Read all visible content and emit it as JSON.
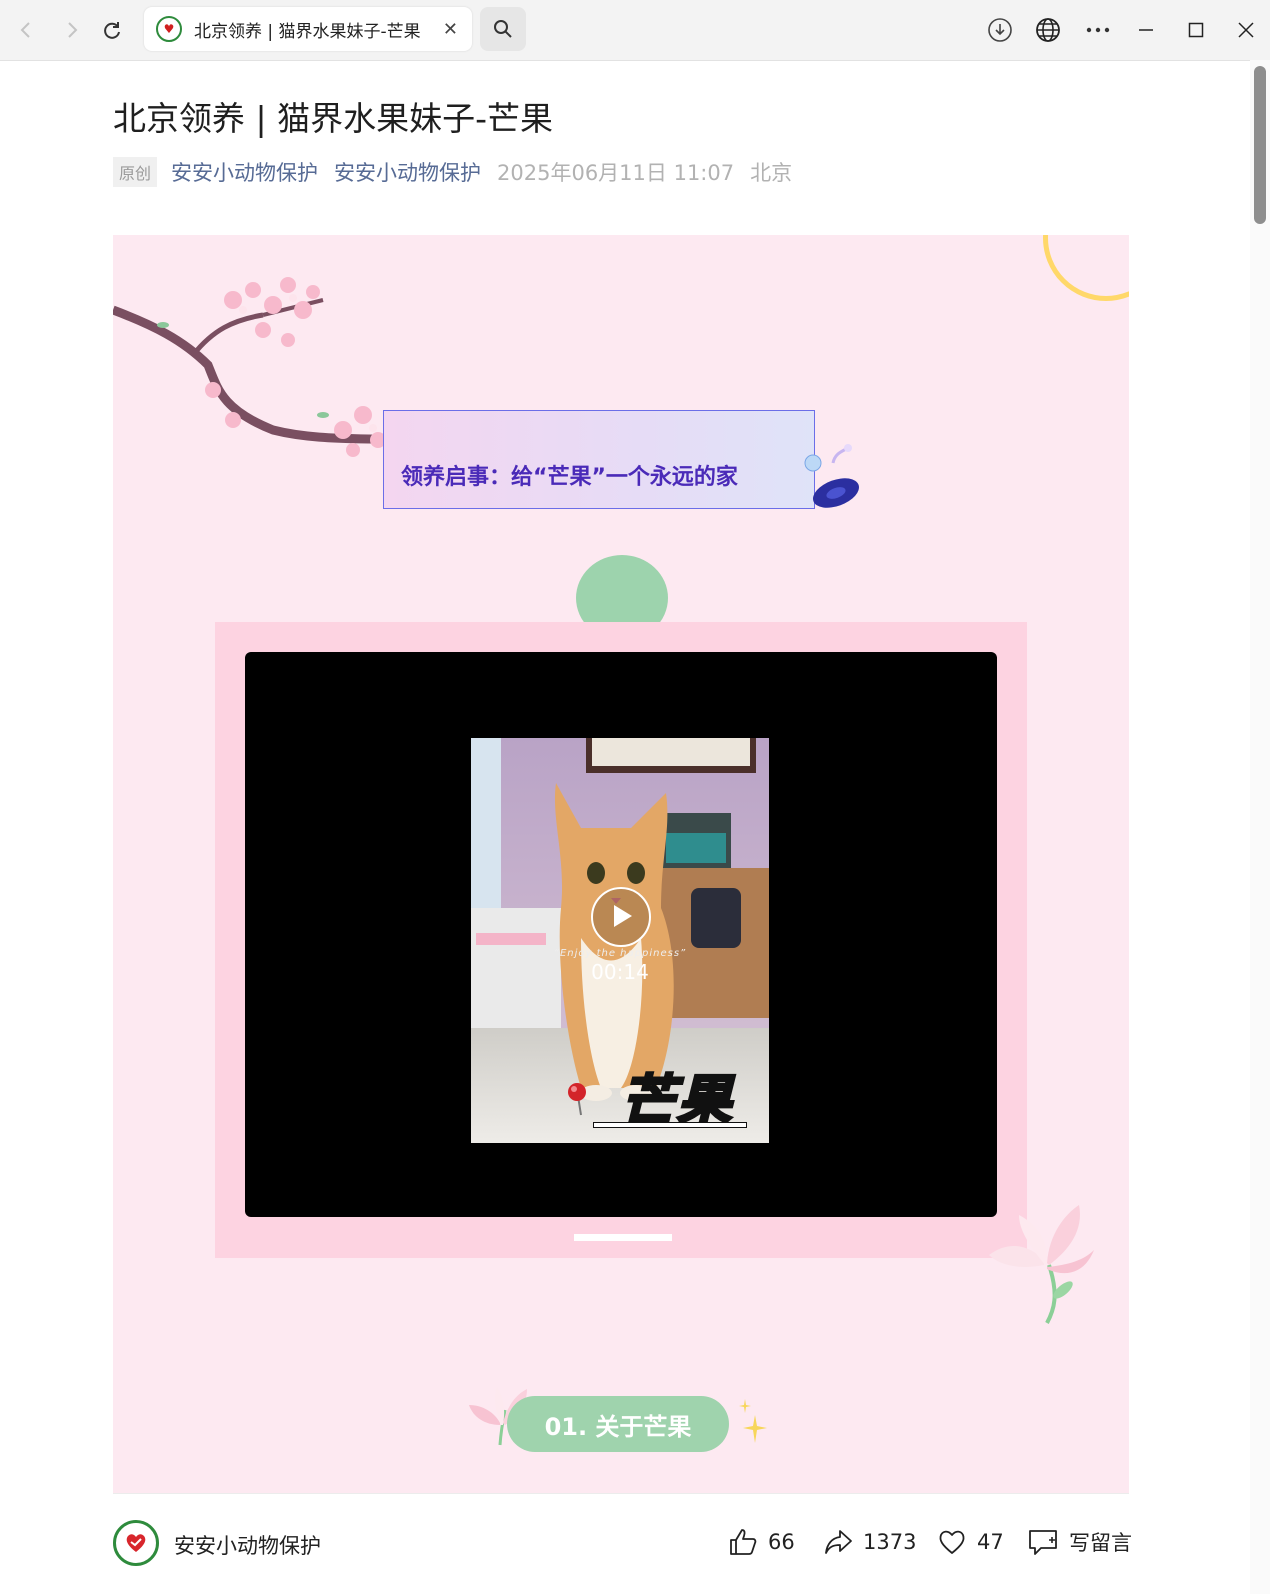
{
  "browser": {
    "tab_title": "北京领养 | 猫界水果妹子-芒果",
    "icons": [
      "back-icon",
      "forward-icon",
      "refresh-icon",
      "close-icon",
      "search-icon",
      "download-icon",
      "globe-icon",
      "more-icon",
      "minimize-icon",
      "maximize-icon",
      "window-close-icon"
    ]
  },
  "article": {
    "title": "北京领养 | 猫界水果妹子-芒果",
    "original_tag": "原创",
    "author": "安安小动物保护",
    "account": "安安小动物保护",
    "datetime": "2025年06月11日 11:07",
    "location": "北京"
  },
  "poster": {
    "banner_text": "领养启事：给“芒果”一个永远的家",
    "video": {
      "caption": "“Enjoy the happiness”",
      "duration": "00:14",
      "overlay_title": "芒果"
    },
    "section_title": "01. 关于芒果"
  },
  "footer": {
    "account_name": "安安小动物保护",
    "likes": "66",
    "shares": "1373",
    "favorites": "47",
    "comment_label": "写留言"
  },
  "colors": {
    "poster_bg": "#fde9f1",
    "frame_pink": "#fdd3e1",
    "mint": "#9fd3ad",
    "banner_text": "#4a2ab8",
    "author_link": "#576b95"
  }
}
